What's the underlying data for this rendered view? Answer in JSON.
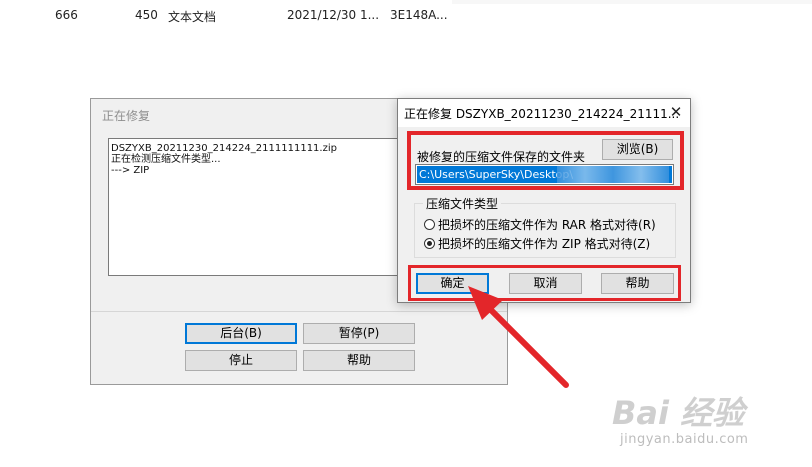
{
  "file_row": {
    "name": "666",
    "size": "450",
    "type": "文本文档",
    "date": "2021/12/30 1...",
    "crc": "3E148A..."
  },
  "back_dialog": {
    "title": "正在修复",
    "log_lines": [
      "DSZYXB_20211230_214224_2111111111.zip",
      "正在检测压缩文件类型...",
      "---> ZIP"
    ],
    "buttons": {
      "background": "后台(B)",
      "pause": "暂停(P)",
      "stop": "停止",
      "help": "帮助"
    }
  },
  "front_dialog": {
    "title": "正在修复 DSZYXB_20211230_214224_21111...",
    "close_glyph": "✕",
    "folder_label": "被修复的压缩文件保存的文件夹",
    "browse_button": "浏览(B)",
    "path_value": "C:\\Users\\SuperSky\\Desktop\\",
    "group_title": "压缩文件类型",
    "radio_rar": "把损坏的压缩文件作为 RAR 格式对待(R)",
    "radio_zip": "把损坏的压缩文件作为 ZIP 格式对待(Z)",
    "selected_type": "ZIP",
    "ok_button": "确定",
    "cancel_button": "取消",
    "help_button": "帮助"
  },
  "watermark": {
    "main": "Bai 经验",
    "sub": "jingyan.baidu.com"
  },
  "colors": {
    "highlight_red": "#e3262a",
    "selection_blue": "#0078d7",
    "dialog_bg": "#f0f0f0"
  }
}
